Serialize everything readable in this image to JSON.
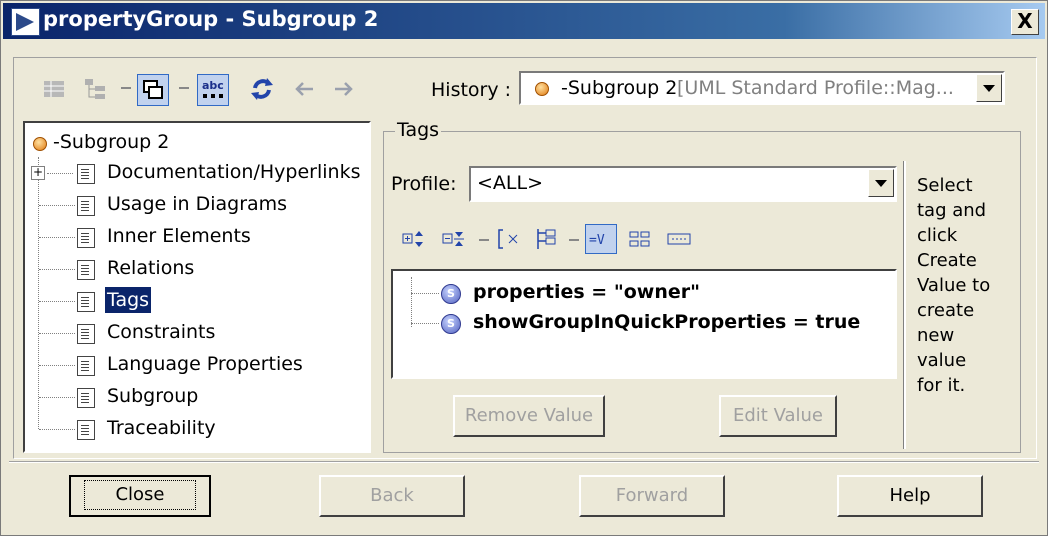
{
  "window": {
    "title": "propertyGroup - Subgroup 2",
    "close_label": "X"
  },
  "toolbar": {
    "history_label": "History :",
    "history_value": "-Subgroup 2",
    "history_suffix": "[UML Standard Profile::Mag...",
    "icons": [
      "list-view-icon",
      "tree-view-icon",
      "window-icon",
      "abc-text-icon",
      "refresh-icon",
      "back-arrow-icon",
      "forward-arrow-icon"
    ]
  },
  "tree": {
    "root": "-Subgroup 2",
    "items": [
      "Documentation/Hyperlinks",
      "Usage in Diagrams",
      "Inner Elements",
      "Relations",
      "Tags",
      "Constraints",
      "Language Properties",
      "Subgroup",
      "Traceability"
    ],
    "selected_index": 4
  },
  "tags": {
    "group_title": "Tags",
    "profile_label": "Profile:",
    "profile_value": "<ALL>",
    "values": [
      "properties = \"owner\"",
      "showGroupInQuickProperties = true"
    ],
    "remove_label": "Remove Value",
    "edit_label": "Edit Value",
    "hint": "Select tag and click Create Value to create new value for it.",
    "hint_lines": [
      "Select",
      "tag and",
      "click",
      "Create",
      "Value to",
      "create",
      "new",
      "value",
      "for it."
    ]
  },
  "footer": {
    "close_label": "Close",
    "back_label": "Back",
    "forward_label": "Forward",
    "help_label": "Help"
  },
  "colors": {
    "dialog_bg": "#ECE9D8",
    "titlebar_start": "#0A246A",
    "selection": "#0A246A",
    "disabled_text": "#A0A0A0"
  }
}
